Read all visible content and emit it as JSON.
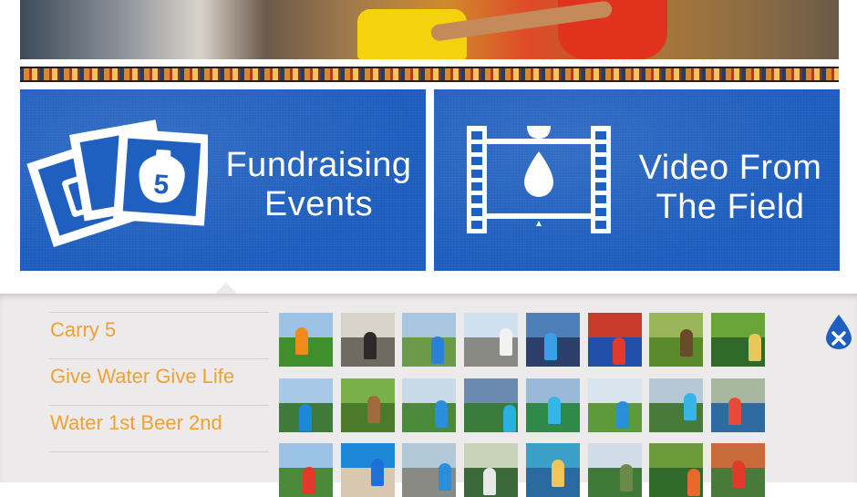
{
  "tiles": [
    {
      "title_line1": "Fundraising",
      "title_line2": "Events"
    },
    {
      "title_line1": "Video From",
      "title_line2": "The Field"
    }
  ],
  "menu": {
    "items": [
      "Carry 5",
      "Give Water Give Life",
      "Water 1st Beer 2nd"
    ]
  },
  "icons": {
    "photos": "photo-stack-icon",
    "video": "film-strip-water-icon",
    "close": "water-drop-close-icon",
    "photo_badge_number": "5"
  },
  "colors": {
    "tile_blue": "#1e5fc0",
    "menu_orange": "#f0a035",
    "panel_gray": "#eceaea",
    "close_blue": "#1e5fc0"
  },
  "thumbnails": [
    {
      "sky": "#9cc3e6",
      "ground": "#3f8f2c",
      "fig": "#f08a1c"
    },
    {
      "sky": "#d8d4cc",
      "ground": "#6f6a62",
      "fig": "#2c2a28"
    },
    {
      "sky": "#a9c6e0",
      "ground": "#6a9a4a",
      "fig": "#2a7fd8"
    },
    {
      "sky": "#cfe0ee",
      "ground": "#8a8a84",
      "fig": "#f2f2f2"
    },
    {
      "sky": "#4e7fb8",
      "ground": "#2c3e6a",
      "fig": "#39a0e8"
    },
    {
      "sky": "#c83a2a",
      "ground": "#1f4fa8",
      "fig": "#e23a2a"
    },
    {
      "sky": "#9ab55a",
      "ground": "#5a8a2c",
      "fig": "#6a4a2a"
    },
    {
      "sky": "#6aa53a",
      "ground": "#2f6a2a",
      "fig": "#e8c85a"
    },
    {
      "sky": "#a8c8e8",
      "ground": "#3f7a3a",
      "fig": "#1e88d8"
    },
    {
      "sky": "#7ab04a",
      "ground": "#4a7a2a",
      "fig": "#a06a3a"
    },
    {
      "sky": "#c8dae8",
      "ground": "#4a8a3a",
      "fig": "#2a8fd8"
    },
    {
      "sky": "#6a8ab0",
      "ground": "#3a7a3a",
      "fig": "#2ab0e0"
    },
    {
      "sky": "#9ab8d8",
      "ground": "#2f8a4a",
      "fig": "#35b6e6"
    },
    {
      "sky": "#d8e4ee",
      "ground": "#5f9a3a",
      "fig": "#2a8fd8"
    },
    {
      "sky": "#b6c8d6",
      "ground": "#4a7a3a",
      "fig": "#35b6e6"
    },
    {
      "sky": "#a8b8a0",
      "ground": "#2f6aa0",
      "fig": "#e84a3a"
    },
    {
      "sky": "#9cc3e6",
      "ground": "#4a8a3a",
      "fig": "#e23a2a"
    },
    {
      "sky": "#1e88d8",
      "ground": "#d8c8b0",
      "fig": "#1e6fd8"
    },
    {
      "sky": "#b0c8d8",
      "ground": "#8a8a84",
      "fig": "#2a8fd8"
    },
    {
      "sky": "#c8d4b8",
      "ground": "#3a6a3a",
      "fig": "#e8e8e8"
    },
    {
      "sky": "#3aa0c8",
      "ground": "#2a6aa0",
      "fig": "#f2c45a"
    },
    {
      "sky": "#d0dce8",
      "ground": "#3f7a3a",
      "fig": "#6a8a4a"
    },
    {
      "sky": "#6a9a3a",
      "ground": "#2f6a2a",
      "fig": "#e86a2a"
    },
    {
      "sky": "#c86a3a",
      "ground": "#4a7a3a",
      "fig": "#e23a2a"
    }
  ]
}
